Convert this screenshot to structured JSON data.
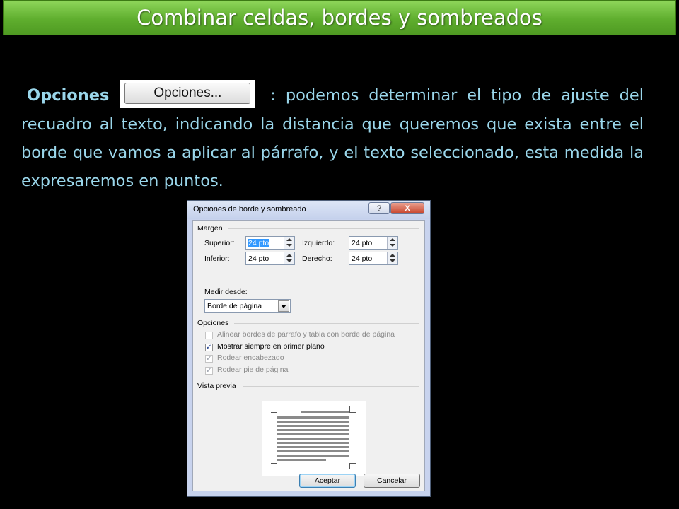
{
  "slide": {
    "title": "Combinar celdas, bordes y sombreados",
    "lead": "Opciones",
    "button_label": "Opciones...",
    "line1_rest": ": podemos determinar el tipo de ajuste",
    "line2": "del recuadro al texto, indicando la distancia que queremos que",
    "line3": "exista entre el borde que vamos a aplicar al párrafo, y el texto",
    "line4": "seleccionado, esta medida la expresaremos en puntos."
  },
  "dialog": {
    "title": "Opciones de borde y sombreado",
    "help_label": "?",
    "close_label": "X",
    "margin_section": "Margen",
    "fields": {
      "superior_label": "Superior:",
      "superior_value": "24 pto",
      "izquierdo_label": "Izquierdo:",
      "izquierdo_value": "24 pto",
      "inferior_label": "Inferior:",
      "inferior_value": "24 pto",
      "derecho_label": "Derecho:",
      "derecho_value": "24 pto"
    },
    "measure_label": "Medir desde:",
    "measure_value": "Borde de página",
    "options_section": "Opciones",
    "checkboxes": [
      {
        "label": "Alinear bordes de párrafo y tabla con borde de página",
        "checked": false,
        "enabled": false
      },
      {
        "label": "Mostrar siempre en primer plano",
        "checked": true,
        "enabled": true
      },
      {
        "label": "Rodear encabezado",
        "checked": true,
        "enabled": false
      },
      {
        "label": "Rodear pie de página",
        "checked": true,
        "enabled": false
      }
    ],
    "preview_section": "Vista previa",
    "ok_label": "Aceptar",
    "cancel_label": "Cancelar",
    "checkmark": "✓"
  }
}
